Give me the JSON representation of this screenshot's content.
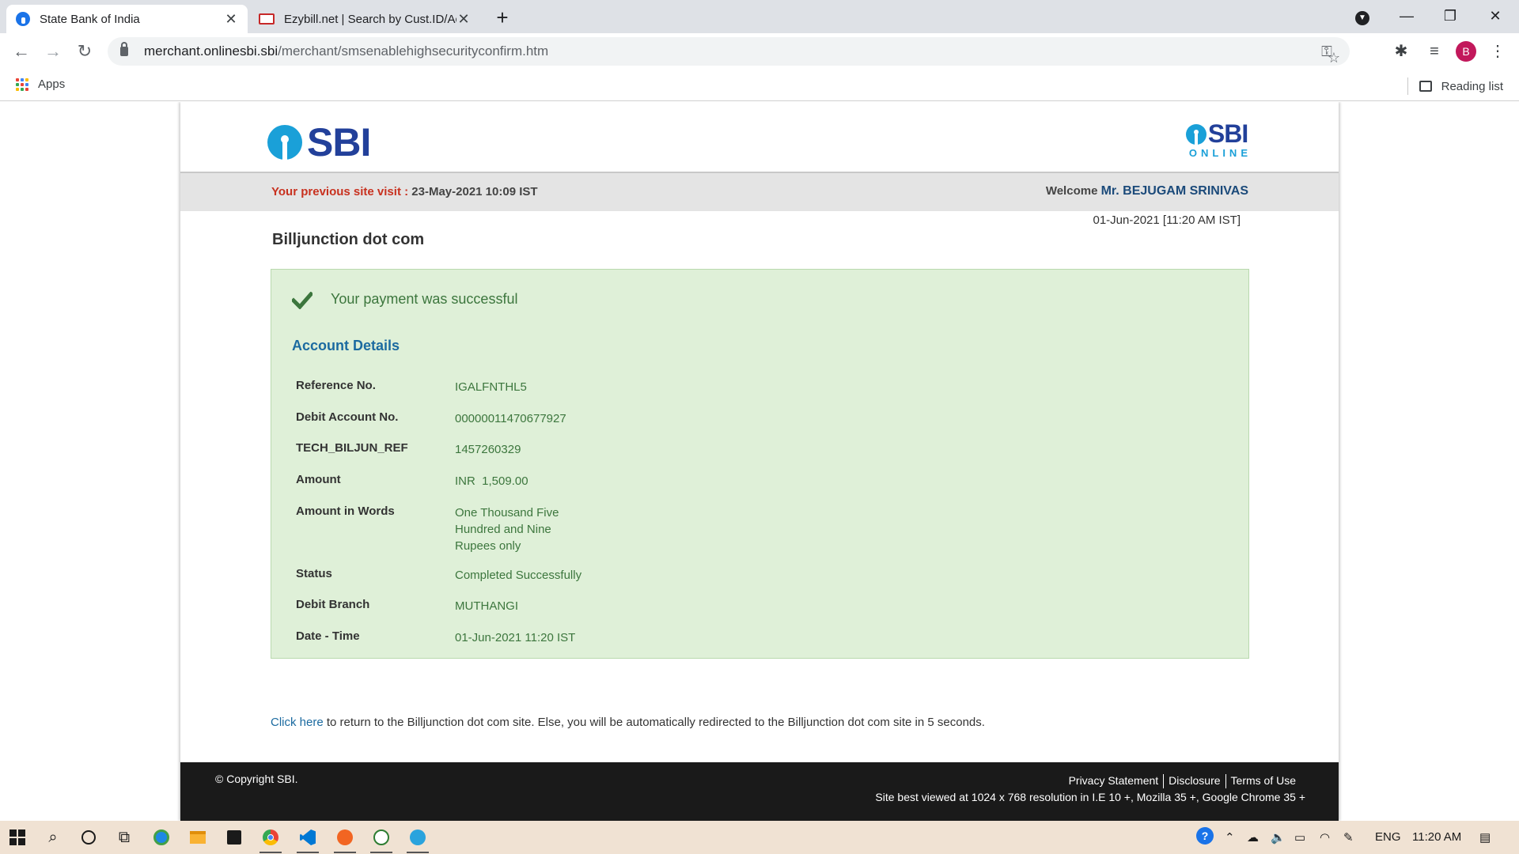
{
  "browser": {
    "tabs": [
      {
        "title": "State Bank of India",
        "active": true
      },
      {
        "title": "Ezybill.net | Search by Cust.ID/Ac",
        "active": false
      }
    ],
    "url_host": "merchant.onlinesbi.sbi",
    "url_path": "/merchant/smsenablehighsecurityconfirm.htm",
    "bookmarks": {
      "apps_label": "Apps",
      "reading_list_label": "Reading list"
    },
    "profile_initial": "B"
  },
  "header": {
    "logo_text": "SBI",
    "online_logo_text": "SBI",
    "online_tag": "ONLINE"
  },
  "infobar": {
    "prev_visit_label": "Your previous site visit :",
    "prev_visit_value": "23-May-2021 10:09 IST",
    "welcome_label": "Welcome",
    "welcome_name": "Mr. BEJUGAM SRINIVAS"
  },
  "page": {
    "datetime": "01-Jun-2021 [11:20 AM IST]",
    "merchant_title": "Billjunction dot com",
    "success_message": "Your payment was successful",
    "account_heading": "Account Details",
    "details": [
      {
        "label": "Reference No.",
        "value": "IGALFNTHL5"
      },
      {
        "label": "Debit Account No.",
        "value": "00000011470677927"
      },
      {
        "label": "TECH_BILJUN_REF",
        "value": "1457260329"
      },
      {
        "label": "Amount",
        "value": "INR  1,509.00"
      },
      {
        "label": "Amount in Words",
        "value": "One Thousand Five Hundred and Nine Rupees only"
      },
      {
        "label": "Status",
        "value": "Completed Successfully"
      },
      {
        "label": "Debit Branch",
        "value": "MUTHANGI"
      },
      {
        "label": "Date - Time",
        "value": "01-Jun-2021 11:20 IST"
      }
    ],
    "redirect_link": "Click here",
    "redirect_text": " to return to the Billjunction dot com site. Else, you will be automatically redirected to the Billjunction dot com site in 5 seconds."
  },
  "footer": {
    "copyright": "© Copyright SBI.",
    "links": [
      "Privacy Statement",
      "Disclosure",
      "Terms of Use"
    ],
    "best_viewed": "Site best viewed at 1024 x 768 resolution in I.E 10 +, Mozilla 35 +, Google Chrome 35 +"
  },
  "taskbar": {
    "lang": "ENG",
    "time": "11:20 AM"
  },
  "colors": {
    "sbi_blue": "#22409a",
    "sbi_cyan": "#1aa0d8",
    "success_bg": "#dff0d8",
    "success_text": "#3c763d",
    "heading_blue": "#1b6aa0",
    "alert_red": "#c8311f"
  }
}
